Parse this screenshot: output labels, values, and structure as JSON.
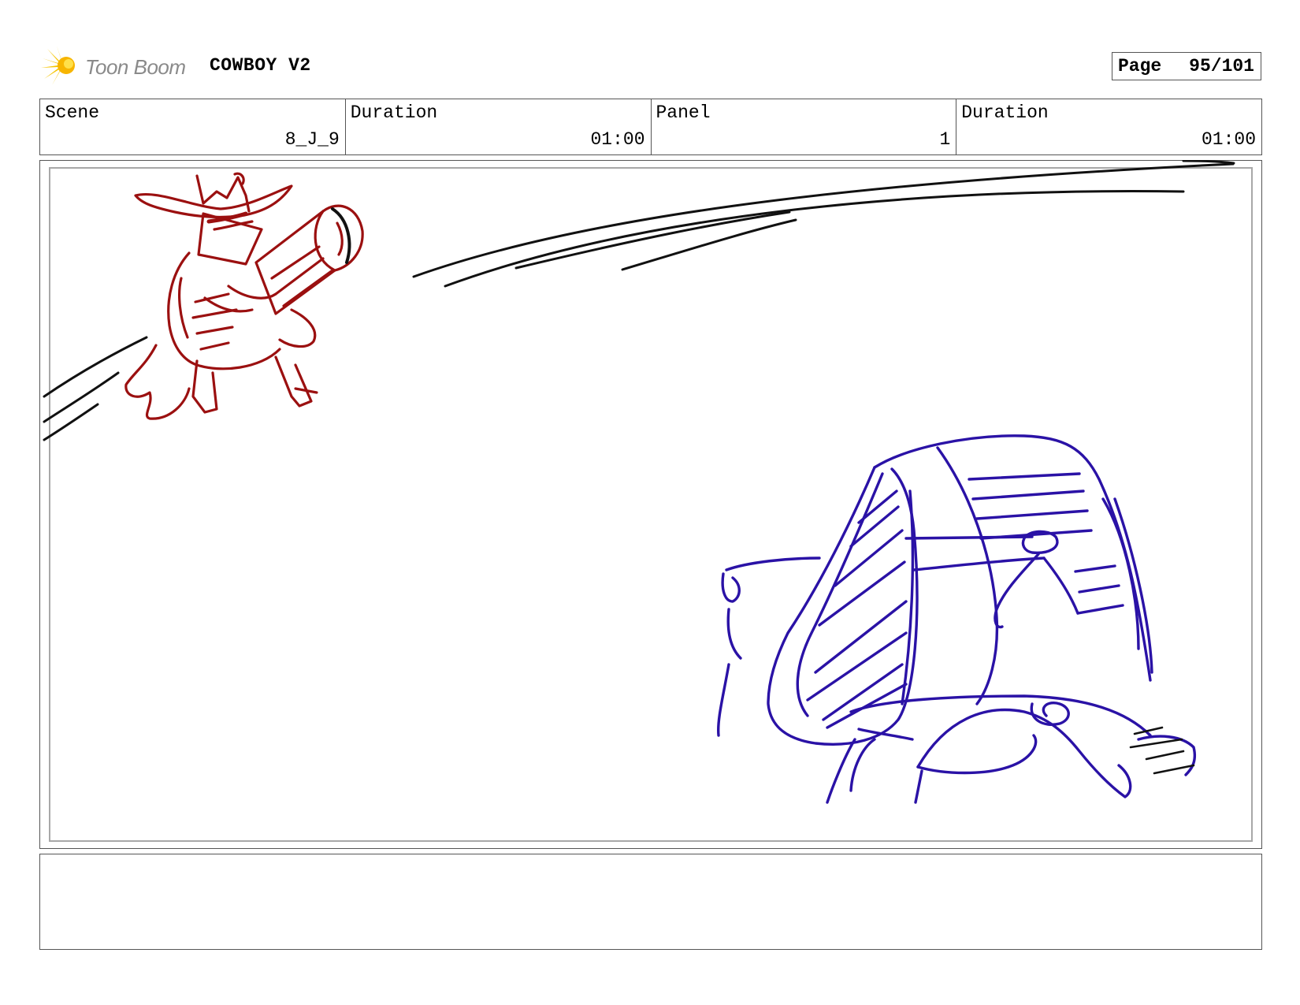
{
  "header": {
    "logo_text": "Toon Boom",
    "project_title": "COWBOY V2",
    "page_label": "Page",
    "page_value": "95/101"
  },
  "info": {
    "scene_label": "Scene",
    "scene_value": "8_J_9",
    "duration_label": "Duration",
    "duration_value": "01:00",
    "panel_label": "Panel",
    "panel_value": "1",
    "panel_duration_label": "Duration",
    "panel_duration_value": "01:00"
  },
  "notes": {
    "text": ""
  },
  "colors": {
    "cowboy_sketch": "#9b1010",
    "creature_sketch": "#2a12a6",
    "motion_lines": "#111111",
    "logo_burst": "#f5c400"
  }
}
